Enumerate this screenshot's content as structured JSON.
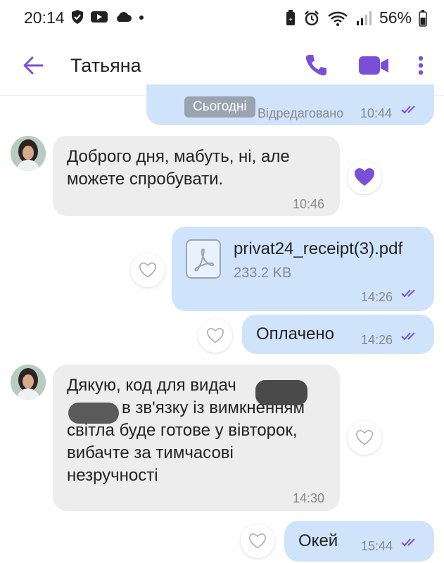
{
  "status_bar": {
    "time": "20:14",
    "battery": "56%"
  },
  "header": {
    "contact_name": "Татьяна"
  },
  "date_chip": "Сьогодні",
  "messages": [
    {
      "dir": "out",
      "edited": "Відредаговано",
      "time": "10:44"
    },
    {
      "dir": "in",
      "text_lines": [
        "Доброго дня, мабуть, ні, але",
        "можете спробувати."
      ],
      "time": "10:46",
      "reaction": "heart-filled"
    },
    {
      "dir": "out",
      "file": {
        "name": "privat24_receipt(3).pdf",
        "size": "233.2 KB"
      },
      "time": "14:26"
    },
    {
      "dir": "out",
      "text": "Оплачено",
      "time": "14:26"
    },
    {
      "dir": "in",
      "text_lines": [
        "Дякую, код для видач",
        "в зв'язку із вимкненням",
        "світла буде готове у вівторок,",
        "вибачте за тимчасові",
        "незручності"
      ],
      "time": "14:30"
    },
    {
      "dir": "out",
      "text": "Окей",
      "time": "15:44"
    }
  ],
  "colors": {
    "accent": "#7a4fd8",
    "incoming_bubble": "#ededee",
    "outgoing_bubble": "#cfe3fb"
  }
}
